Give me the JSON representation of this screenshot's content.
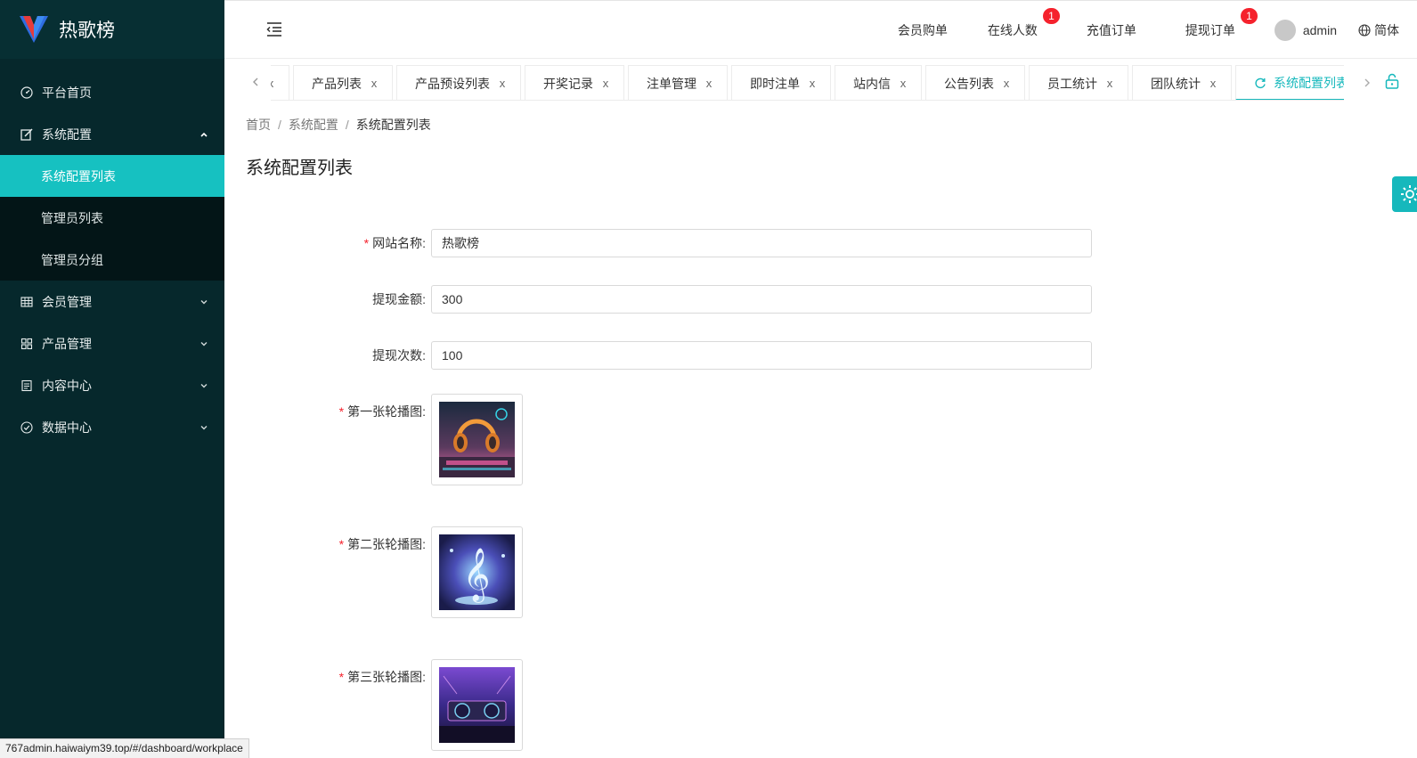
{
  "app": {
    "title": "热歌榜"
  },
  "sidebar": {
    "items": [
      {
        "label": "平台首页",
        "icon": "dashboard-icon"
      },
      {
        "label": "系统配置",
        "icon": "edit-icon",
        "expanded": true
      },
      {
        "label": "会员管理",
        "icon": "table-icon"
      },
      {
        "label": "产品管理",
        "icon": "apps-icon"
      },
      {
        "label": "内容中心",
        "icon": "document-icon"
      },
      {
        "label": "数据中心",
        "icon": "check-circle-icon"
      }
    ],
    "sub_items": [
      {
        "label": "系统配置列表",
        "active": true
      },
      {
        "label": "管理员列表"
      },
      {
        "label": "管理员分组"
      }
    ]
  },
  "topbar": {
    "links": [
      {
        "label": "会员购单"
      },
      {
        "label": "在线人数",
        "badge": "1"
      },
      {
        "label": "充值订单"
      },
      {
        "label": "提现订单",
        "badge": "1"
      }
    ],
    "user": "admin",
    "language": "简体"
  },
  "tabs": [
    {
      "label": "页"
    },
    {
      "label": "产品列表"
    },
    {
      "label": "产品预设列表"
    },
    {
      "label": "开奖记录"
    },
    {
      "label": "注单管理"
    },
    {
      "label": "即时注单"
    },
    {
      "label": "站内信"
    },
    {
      "label": "公告列表"
    },
    {
      "label": "员工统计"
    },
    {
      "label": "团队统计"
    },
    {
      "label": "系统配置列表",
      "active": true
    }
  ],
  "tab_close_glyph": "x",
  "breadcrumb": [
    "首页",
    "系统配置",
    "系统配置列表"
  ],
  "breadcrumb_sep": "/",
  "page_title": "系统配置列表",
  "form": {
    "site_name": {
      "label": "网站名称:",
      "value": "热歌榜",
      "required": true
    },
    "withdraw_amount": {
      "label": "提现金额:",
      "value": "300",
      "required": false
    },
    "withdraw_times": {
      "label": "提现次数:",
      "value": "100",
      "required": false
    },
    "banner1": {
      "label": "第一张轮播图:",
      "required": true
    },
    "banner2": {
      "label": "第二张轮播图:",
      "required": true
    },
    "banner3": {
      "label": "第三张轮播图:",
      "required": true
    }
  },
  "required_mark": "*",
  "status_url": "767admin.haiwaiym39.top/#/dashboard/workplace",
  "colors": {
    "sidebar_bg": "#06282c",
    "accent": "#16c1c1",
    "badge": "#f5222d"
  }
}
